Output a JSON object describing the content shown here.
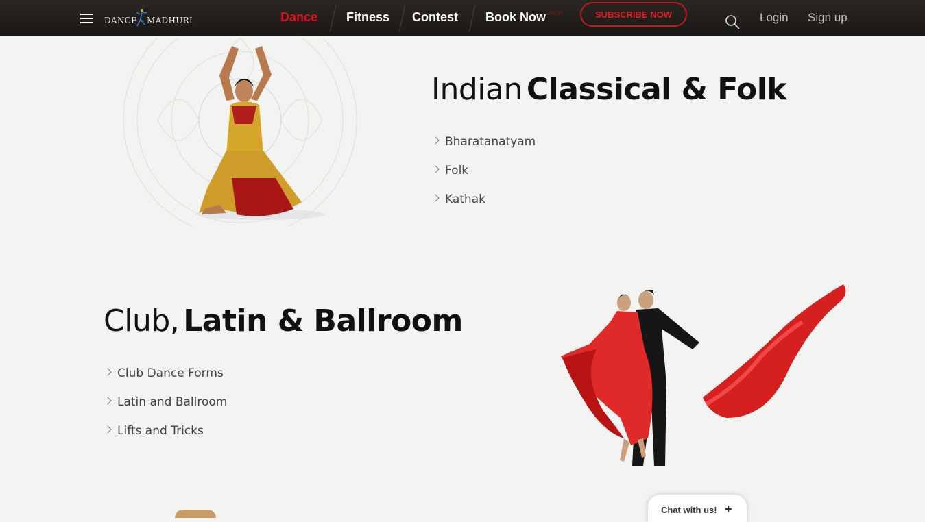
{
  "colors": {
    "accent": "#e0101b",
    "topbar": "#221f1c",
    "background": "#f3f3f2"
  },
  "logo": {
    "part1": "DANCE",
    "part2": "MADHURI",
    "small": "WITH"
  },
  "nav": {
    "items": [
      {
        "label": "Dance",
        "active": true
      },
      {
        "label": "Fitness",
        "active": false
      },
      {
        "label": "Contest",
        "active": false
      },
      {
        "label": "Book Now",
        "active": false
      }
    ],
    "new_badge": "NEW",
    "subscribe": "SUBSCRIBE NOW",
    "login": "Login",
    "signup": "Sign up",
    "icons": [
      "menu-icon",
      "search-icon"
    ]
  },
  "sections": [
    {
      "title_light": "Indian",
      "title_bold": "Classical & Folk",
      "items": [
        "Bharatanatyam",
        "Folk",
        "Kathak"
      ]
    },
    {
      "title_light": "Club,",
      "title_bold": "Latin & Ballroom",
      "items": [
        "Club Dance Forms",
        "Latin and Ballroom",
        "Lifts and Tricks"
      ]
    }
  ],
  "chat": {
    "label": "Chat with us!",
    "icon": "plus-icon"
  }
}
